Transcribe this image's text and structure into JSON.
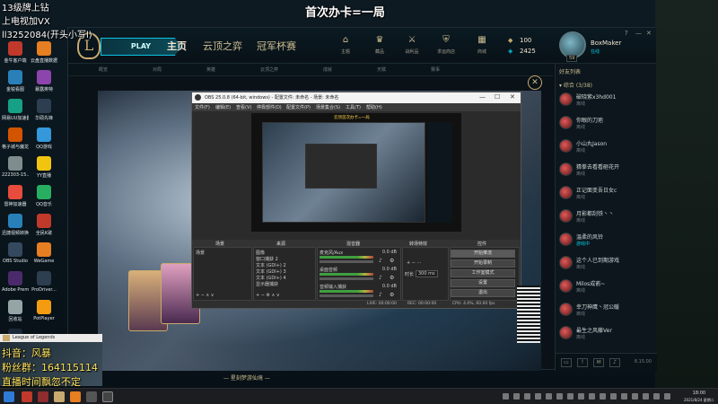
{
  "overlay": {
    "top_center": "首次办卡=一局",
    "top_left_1": "13级牌上钻",
    "top_left_2": "上电视加VX",
    "top_left_3": "ll3252084(开头小写l)",
    "bottom_1": "抖音：风暴",
    "bottom_2": "粉丝群：164115114",
    "bottom_3": "直播时间飘忽不定"
  },
  "desktop": {
    "icons": [
      {
        "label": "金牛客户端",
        "color": "#c0392b"
      },
      {
        "label": "云盘直播数据",
        "color": "#e67e22"
      },
      {
        "label": "金锐看图",
        "color": "#2980b9"
      },
      {
        "label": "暴露英特",
        "color": "#8e44ad"
      },
      {
        "label": "网易UU加速器",
        "color": "#16a085"
      },
      {
        "label": "华硕先锋",
        "color": "#2c3e50"
      },
      {
        "label": "格子城与魔龙",
        "color": "#d35400"
      },
      {
        "label": "QQ游戏",
        "color": "#3498db"
      },
      {
        "label": "222303-15...",
        "color": "#7f8c8d"
      },
      {
        "label": "YY直播",
        "color": "#f1c40f"
      },
      {
        "label": "雷神加速器",
        "color": "#e74c3c"
      },
      {
        "label": "QQ音乐",
        "color": "#27ae60"
      },
      {
        "label": "迅捷视频转换器",
        "color": "#2980b9"
      },
      {
        "label": "全民K歌",
        "color": "#c0392b"
      },
      {
        "label": "OBS Studio",
        "color": "#34495e"
      },
      {
        "label": "WeGame",
        "color": "#e67e22"
      },
      {
        "label": "Adobe Premie...",
        "color": "#4b2a6b"
      },
      {
        "label": "ProDriver...",
        "color": "#2c3e50"
      },
      {
        "label": "回收站",
        "color": "#95a5a6"
      },
      {
        "label": "PotPlayer",
        "color": "#f39c12"
      },
      {
        "label": "Steam",
        "color": "#1b2838"
      }
    ]
  },
  "lol": {
    "play_label": "PLAY",
    "tabs": [
      "主页",
      "云顶之弈",
      "冠军杯赛"
    ],
    "top_icons": [
      {
        "label": "主题",
        "icon": "home-icon",
        "glyph": "⌂"
      },
      {
        "label": "藏品",
        "icon": "crown-icon",
        "glyph": "♛"
      },
      {
        "label": "战利品",
        "icon": "swords-icon",
        "glyph": "⚔"
      },
      {
        "label": "求运商店",
        "icon": "shield-icon",
        "glyph": "⛨"
      },
      {
        "label": "商城",
        "icon": "store-icon",
        "glyph": "▦"
      }
    ],
    "currency_rp": "100",
    "currency_be": "2425",
    "username": "BoxMaker",
    "status": "在线",
    "level": "59",
    "sub_tabs": [
      "概览",
      "对局",
      "英雄",
      "云顶之弈",
      "成就",
      "天赋",
      "赛事"
    ],
    "art_caption": "— 星刻梦游仙境 —"
  },
  "friends": {
    "header": "好友列表",
    "group": "▾ 综合 (3/38)",
    "list": [
      {
        "name": "破晓紫x3hd001",
        "status": "离线",
        "online": false
      },
      {
        "name": "你眼的刀疤",
        "status": "离线",
        "online": false
      },
      {
        "name": "小山丸Jason",
        "status": "离线",
        "online": false
      },
      {
        "name": "猜拳去看看砸花开",
        "status": "离线",
        "online": false
      },
      {
        "name": "正记面变吾日女c",
        "status": "离线",
        "online": false
      },
      {
        "name": "月影都刮铁丶丶",
        "status": "离线",
        "online": false
      },
      {
        "name": "温柔的风铃",
        "status": "游戏中",
        "online": true
      },
      {
        "name": "这个人已到期游戏",
        "status": "离线",
        "online": false
      },
      {
        "name": "Milos成嵛~",
        "status": "离线",
        "online": false
      },
      {
        "name": "幸刀神鹰丶冠公暖",
        "status": "离线",
        "online": false
      },
      {
        "name": "最生之风藤Ver",
        "status": "离线",
        "online": false
      }
    ],
    "version": "8.15.00",
    "badge": "5"
  },
  "obs": {
    "title": "OBS 25.0.8 (64-bit, windows) - 配置文件: 未命名 - 场景: 未命名",
    "menu": [
      "文件(F)",
      "编辑(E)",
      "查看(V)",
      "停靠部件(D)",
      "配置文件(P)",
      "场景集合(S)",
      "工具(T)",
      "帮助(H)"
    ],
    "preview_caption": "云顶首次办卡=一局",
    "docks": [
      "场景",
      "来源",
      "混音器",
      "转场特效",
      "控件"
    ],
    "scene": "场景",
    "sources": [
      "图像",
      "窗口捕获 2",
      "文本 (GDI+) 2",
      "文本 (GDI+) 3",
      "文本 (GDI+) 4",
      "显示器捕获"
    ],
    "mixer": [
      {
        "name": "麦克风/Aux",
        "value": "0.0 dB"
      },
      {
        "name": "桌面音频",
        "value": "0.0 dB"
      },
      {
        "name": "音频输入捕获",
        "value": "0.0 dB"
      }
    ],
    "transition_label": "时长",
    "transition_value": "300 ms",
    "controls": [
      "开始推流",
      "开始录制",
      "工作室模式",
      "设置",
      "退出"
    ],
    "status_live": "LIVE: 00:00:00",
    "status_rec": "REC: 00:00:00",
    "status_cpu": "CPU: 4.0%, 60.00 fps"
  },
  "cam": {
    "title": "League of Legends"
  },
  "taskbar": {
    "time": "18:00",
    "date": "2021/8/24 星期二"
  }
}
